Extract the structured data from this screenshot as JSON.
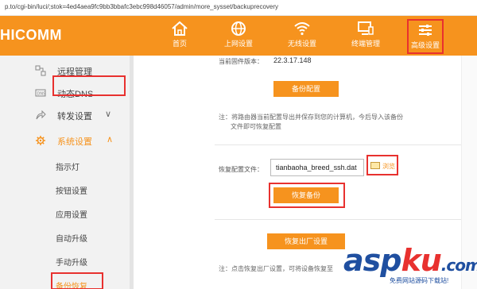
{
  "url": "p.to/cgi-bin/luci/;stok=4ed4aea9fc9bb3bbafc3ebc998d46057/admin/more_sysset/backuprecovery",
  "brand": {
    "logo": "HICOMM",
    "accent": "#f6931e",
    "highlight": "#e8312f"
  },
  "nav": [
    {
      "label": "首页",
      "icon": "home-icon"
    },
    {
      "label": "上网设置",
      "icon": "globe-icon"
    },
    {
      "label": "无线设置",
      "icon": "wifi-icon"
    },
    {
      "label": "终端管理",
      "icon": "monitor-icon"
    },
    {
      "label": "高级设置",
      "icon": "sliders-icon",
      "active": true
    }
  ],
  "sidebar": {
    "items": [
      {
        "label": "远程管理",
        "icon": "remote-icon"
      },
      {
        "label": "动态DNS",
        "icon": "dns-icon"
      },
      {
        "label": "转发设置",
        "icon": "forward-icon",
        "chevron": "∨"
      },
      {
        "label": "系统设置",
        "icon": "gear-icon",
        "chevron": "∧",
        "expanded": true
      }
    ],
    "subitems": [
      "指示灯",
      "按钮设置",
      "应用设置",
      "自动升级",
      "手动升级",
      "备份恢复"
    ],
    "active_subitem": "备份恢复"
  },
  "main": {
    "firmware_label": "当前固件版本：",
    "firmware_value": "22.3.17.148",
    "backup_button": "备份配置",
    "backup_note_line1": "注：将路由器当前配置导出并保存到您的计算机，今后导入该备份",
    "backup_note_line2": "文件即可恢复配置",
    "restore_label": "恢复配置文件：",
    "restore_file": "tianbaoha_breed_ssh.dat",
    "browse_label": "浏览",
    "restore_button": "恢复备份",
    "factory_button": "恢复出厂设置",
    "factory_note": "注：点击恢复出厂设置，可将设备恢复至"
  },
  "watermark": {
    "asp": "asp",
    "ku": "ku",
    "com": ".com",
    "tagline": "免费网站源码下载站!"
  }
}
